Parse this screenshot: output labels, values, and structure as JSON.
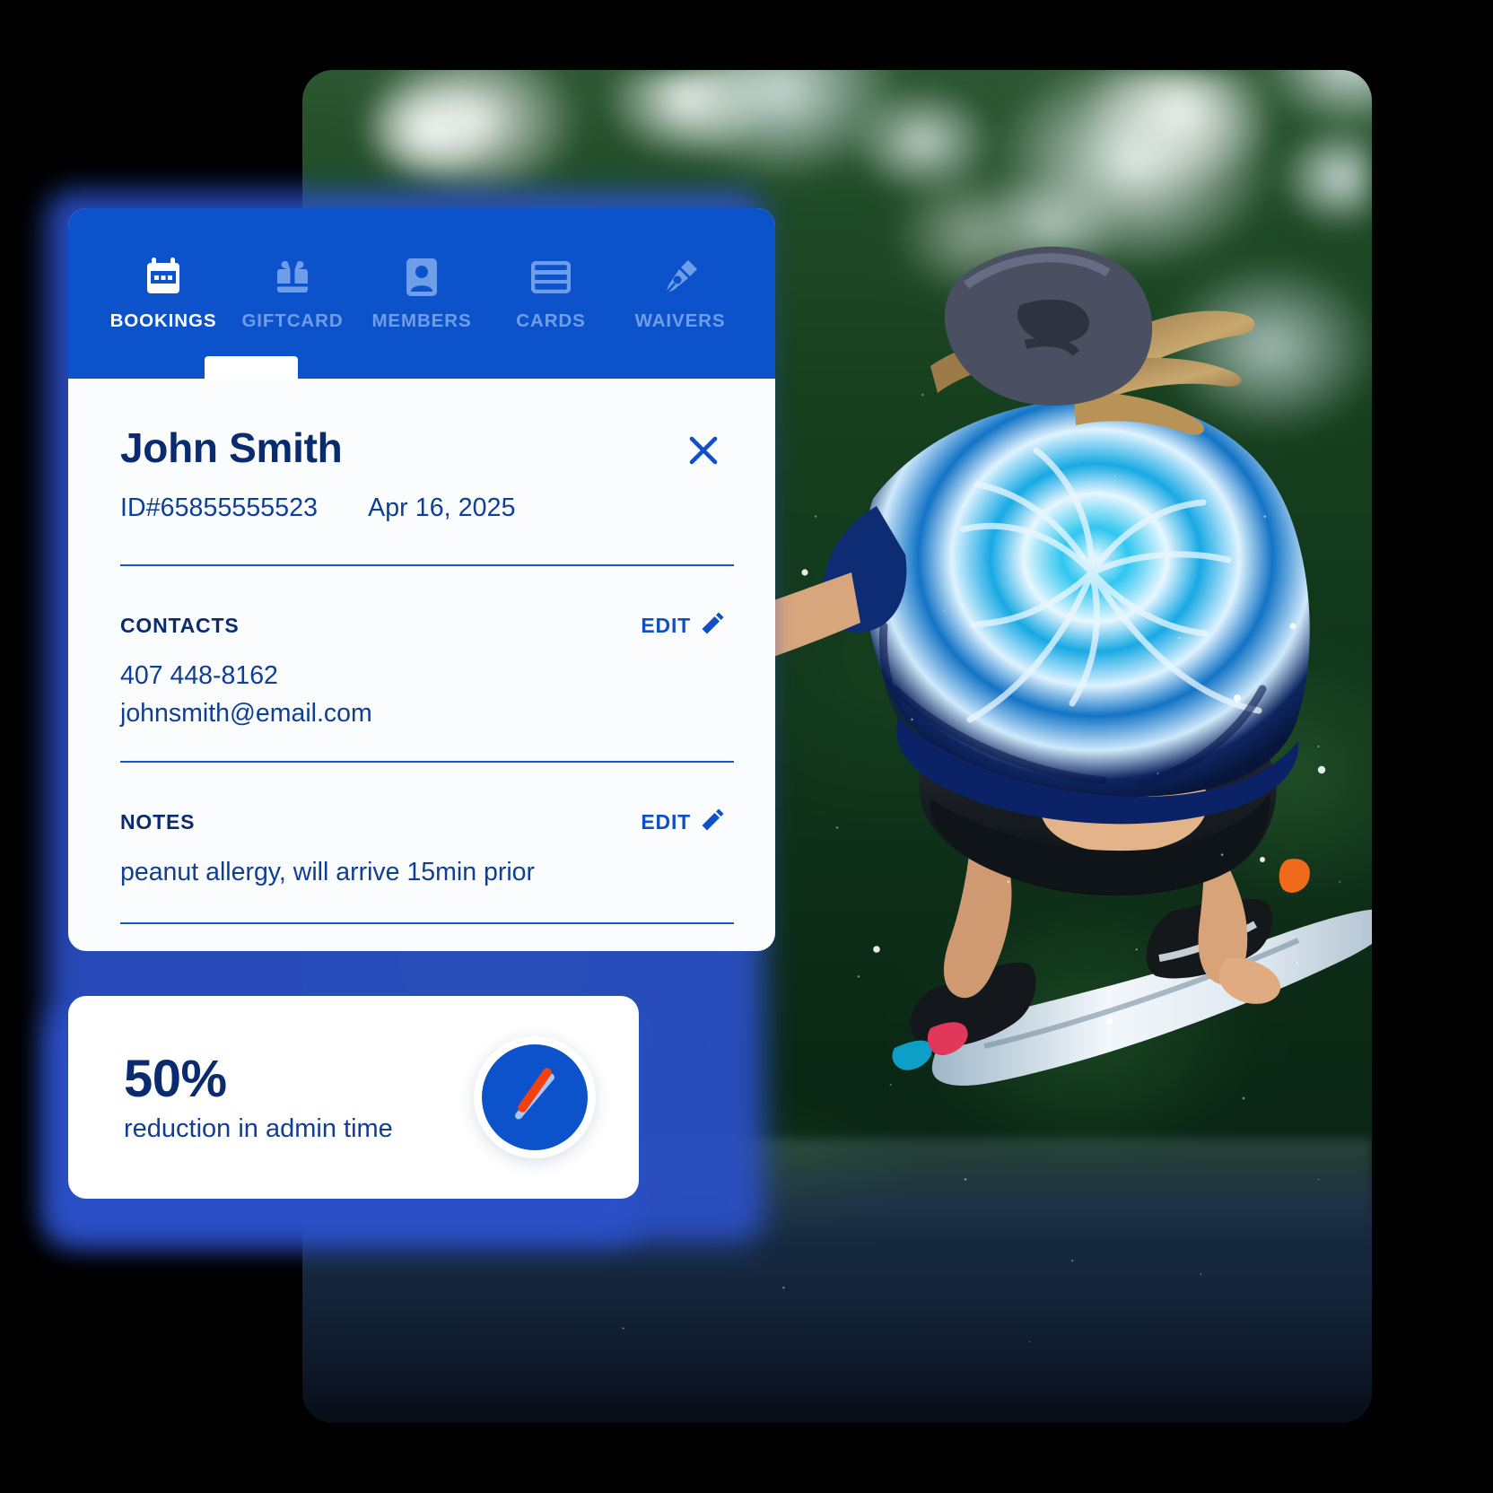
{
  "app": {
    "tabs": [
      {
        "label": "BOOKINGS",
        "icon": "calendar-icon",
        "active": true
      },
      {
        "label": "GIFTCARD",
        "icon": "gift-icon",
        "active": false
      },
      {
        "label": "MEMBERS",
        "icon": "id-badge-icon",
        "active": false
      },
      {
        "label": "CARDS",
        "icon": "credit-card-icon",
        "active": false
      },
      {
        "label": "WAIVERS",
        "icon": "pen-nib-icon",
        "active": false
      }
    ]
  },
  "booking": {
    "customer_name": "John Smith",
    "id_label": "ID#65855555523",
    "date": "Apr 16, 2025",
    "close_icon": "close-icon",
    "contacts": {
      "label": "CONTACTS",
      "edit_label": "EDIT",
      "edit_icon": "pencil-icon",
      "phone": "407 448-8162",
      "email": "johnsmith@email.com"
    },
    "notes": {
      "label": "NOTES",
      "edit_label": "EDIT",
      "edit_icon": "pencil-icon",
      "text": "peanut allergy, will arrive 15min prior"
    }
  },
  "stat": {
    "value": "50%",
    "caption": "reduction in admin time",
    "icon": "clock-icon"
  },
  "photo": {
    "description": "wakeboarder mid-air jump with water spray",
    "alt": "Wakeboarder in blue tie-dye shirt jumping above water"
  },
  "colors": {
    "brand_blue": "#0c53cb",
    "deep_navy": "#0a2b6e",
    "link_blue": "#0f50c8",
    "accent_orange": "#f2400f",
    "light_blue": "#a9c6f7",
    "card_bg": "#fbfcfe",
    "inactive_tab": "#6f9ee8"
  }
}
